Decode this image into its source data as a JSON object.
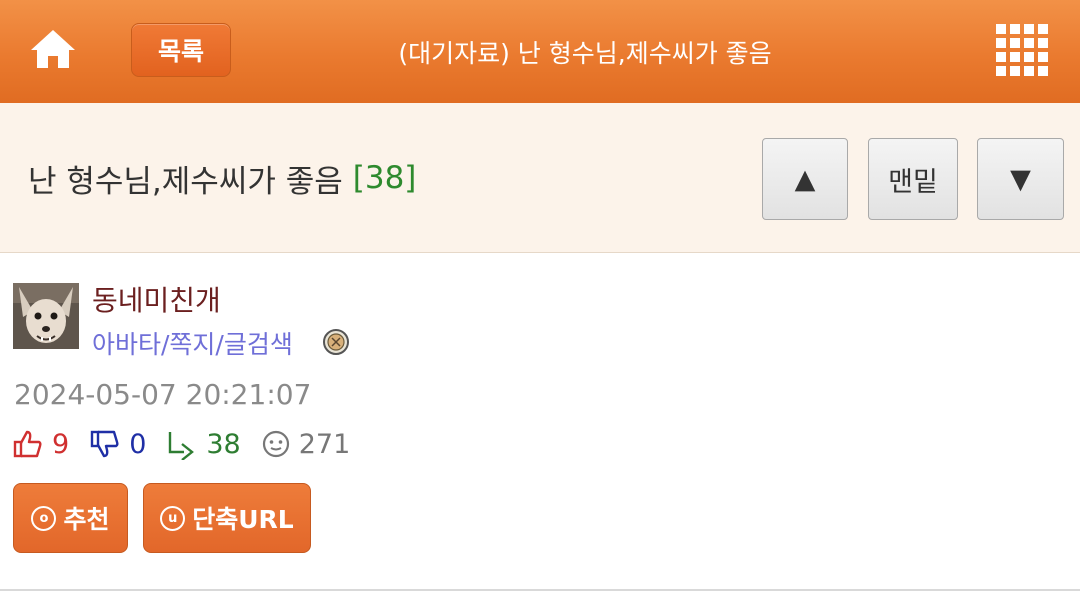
{
  "header": {
    "list_label": "목록",
    "title": "(대기자료) 난 형수님,제수씨가 좋음"
  },
  "post": {
    "title": "난 형수님,제수씨가 좋음",
    "comment_count": "[38]",
    "author": "동네미친개",
    "author_links": "아바타/쪽지/글검색",
    "date": "2024-05-07 20:21:07"
  },
  "nav": {
    "up_symbol": "▲",
    "bottom_label": "맨밑",
    "down_symbol": "▼"
  },
  "stats": {
    "likes": "9",
    "dislikes": "0",
    "replies": "38",
    "views": "271"
  },
  "actions": {
    "recommend_icon": "o",
    "recommend_label": "추천",
    "shorturl_icon": "u",
    "shorturl_label": "단축URL"
  },
  "colors": {
    "header_orange": "#ea7a2f",
    "title_band_bg": "#fcf3ea",
    "count_green": "#2e8a2e",
    "author_color": "#6b1f1f",
    "link_color": "#6f6fd8",
    "like_red": "#d03030",
    "dislike_blue": "#1f2fa6"
  },
  "icons": {
    "home": "home-icon",
    "menu": "grid-menu-icon",
    "like": "thumbs-up-icon",
    "dislike": "thumbs-down-icon",
    "reply": "reply-arrow-icon",
    "views": "face-icon",
    "badge": "badge-icon"
  }
}
